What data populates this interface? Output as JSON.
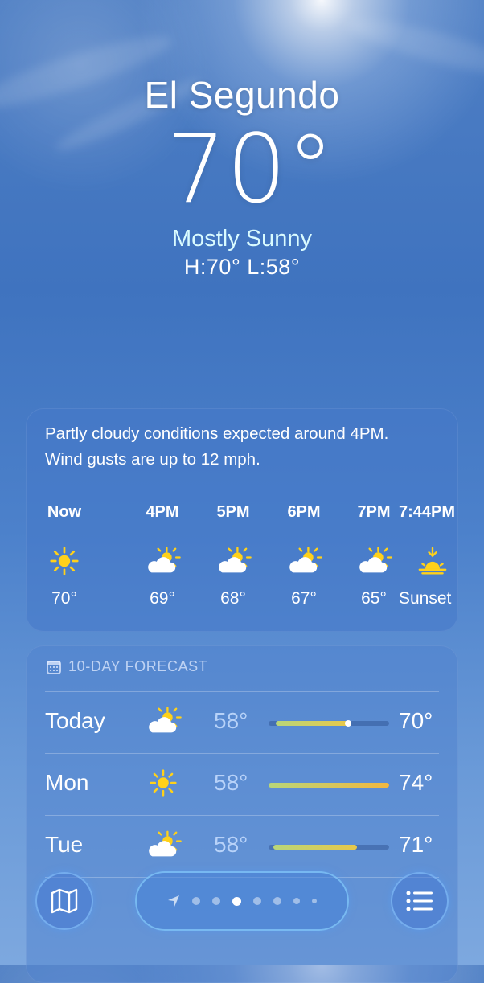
{
  "location": {
    "city": "El Segundo",
    "temperature": "70°",
    "condition": "Mostly Sunny",
    "hi_lo": "H:70°  L:58°"
  },
  "hourly": {
    "summary_line1": "Partly cloudy conditions expected around 4PM.",
    "summary_line2": "Wind gusts are up to 12 mph.",
    "hours": [
      {
        "label": "Now",
        "icon": "sun-icon",
        "value": "70°"
      },
      {
        "label": "4PM",
        "icon": "partly-sunny-icon",
        "value": "69°"
      },
      {
        "label": "5PM",
        "icon": "partly-sunny-icon",
        "value": "68°"
      },
      {
        "label": "6PM",
        "icon": "partly-sunny-icon",
        "value": "67°"
      },
      {
        "label": "7PM",
        "icon": "partly-sunny-icon",
        "value": "65°"
      },
      {
        "label": "7:44PM",
        "icon": "sunset-icon",
        "value": "Sunset"
      }
    ]
  },
  "forecast": {
    "title": "10-DAY FORECAST",
    "days": [
      {
        "day": "Today",
        "icon": "partly-sunny-icon",
        "low": "58°",
        "high": "70°",
        "range_start": 0.06,
        "range_end": 0.66,
        "current": 0.66
      },
      {
        "day": "Mon",
        "icon": "sun-icon",
        "low": "58°",
        "high": "74°",
        "range_start": 0.0,
        "range_end": 1.0
      },
      {
        "day": "Tue",
        "icon": "partly-sunny-icon",
        "low": "58°",
        "high": "71°",
        "range_start": 0.04,
        "range_end": 0.73
      }
    ]
  },
  "navigation": {
    "pages": 7,
    "active_page": 3
  },
  "colors": {
    "sun": "#ffd11a",
    "cond_text": "#d9fbff",
    "bar_cool": "#b8d67a",
    "bar_warm": "#f2b73f"
  }
}
